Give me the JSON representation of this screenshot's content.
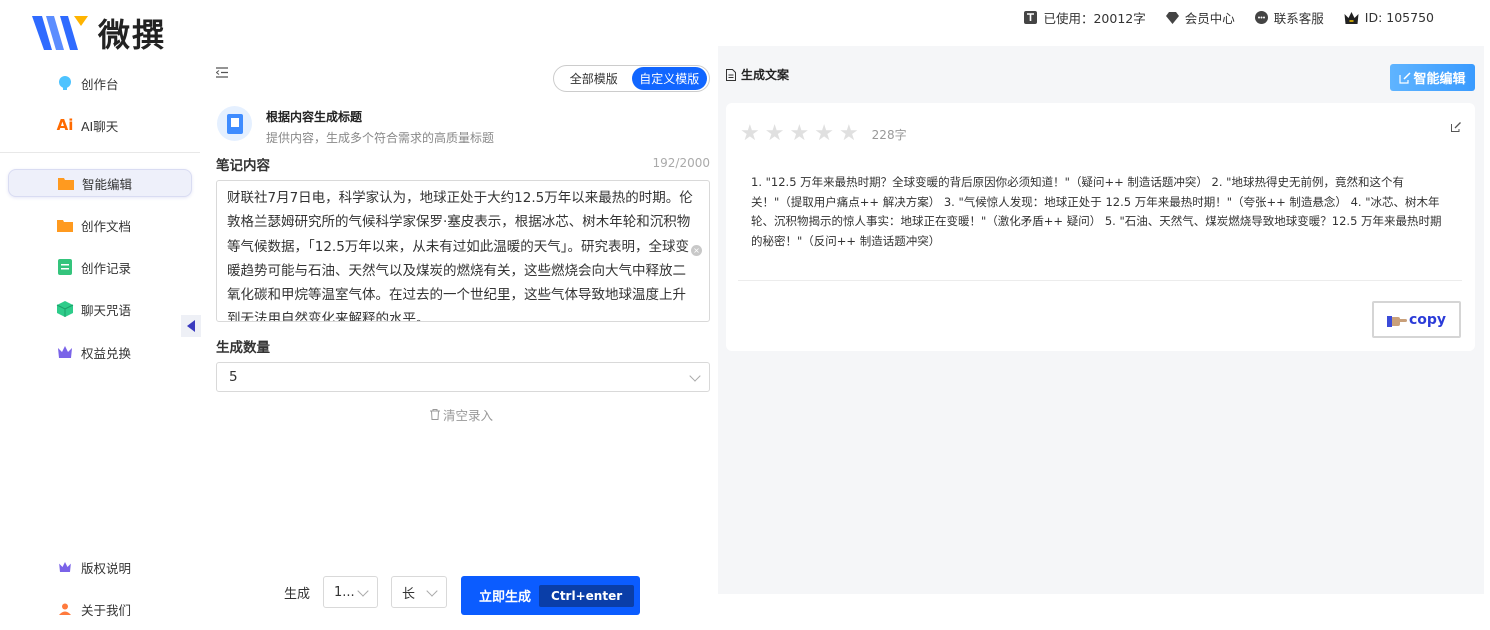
{
  "brand": {
    "name": "微撰"
  },
  "topbar": {
    "usage": "已使用：20012字",
    "member": "会员中心",
    "support": "联系客服",
    "user_id": "ID: 105750"
  },
  "sidebar": {
    "top_items": [
      {
        "label": "创作台",
        "icon": "bulb-icon"
      },
      {
        "label": "AI聊天",
        "icon": "ai-icon"
      }
    ],
    "items": [
      {
        "label": "智能编辑",
        "icon": "folder-icon",
        "active": true
      },
      {
        "label": "创作文档",
        "icon": "folder-icon"
      },
      {
        "label": "创作记录",
        "icon": "document-icon"
      },
      {
        "label": "聊天咒语",
        "icon": "cube-icon"
      },
      {
        "label": "权益兑换",
        "icon": "crown-icon"
      }
    ],
    "bottom_items": [
      {
        "label": "版权说明",
        "icon": "crown-icon"
      },
      {
        "label": "关于我们",
        "icon": "user-icon"
      }
    ],
    "ai_badge": "Ai"
  },
  "template_switch": {
    "all": "全部模版",
    "custom": "自定义模版",
    "selected": "custom"
  },
  "template": {
    "title": "根据内容生成标题",
    "desc": "提供内容，生成多个符合需求的高质量标题"
  },
  "notes": {
    "label": "笔记内容",
    "counter": "192/2000",
    "content": "财联社7月7日电，科学家认为，地球正处于大约12.5万年以来最热的时期。伦敦格兰瑟姆研究所的气候科学家保罗·塞皮表示，根据冰芯、树木年轮和沉积物等气候数据，「12.5万年以来，从未有过如此温暖的天气」。研究表明，全球变暖趋势可能与石油、天然气以及煤炭的燃烧有关，这些燃烧会向大气中释放二氧化碳和甲烷等温室气体。在过去的一个世纪里，这些气体导致地球温度上升到无法用自然变化来解释的水平。"
  },
  "quantity": {
    "label": "生成数量",
    "value": "5"
  },
  "clear_entry": "清空录入",
  "bottom": {
    "gen_label": "生成",
    "select1": "1...",
    "select2": "长",
    "generate_button": "立即生成",
    "shortcut": "Ctrl+enter"
  },
  "output": {
    "header": "生成文案",
    "smart_edit": "智能编辑",
    "rating": 0,
    "word_count": "228字",
    "text": "1. \"12.5 万年来最热时期？全球变暖的背后原因你必须知道！\"（疑问++ 制造话题冲突） 2. \"地球热得史无前例，竟然和这个有关！\"（提取用户痛点++ 解决方案） 3. \"气候惊人发现：地球正处于 12.5 万年来最热时期！\"（夸张++ 制造悬念） 4. \"冰芯、树木年轮、沉积物揭示的惊人事实：地球正在变暖！\"（激化矛盾++ 疑问） 5. \"石油、天然气、煤炭燃烧导致地球变暖？12.5 万年来最热时期的秘密！\"（反问++ 制造话题冲突）",
    "copy_label": "copy"
  },
  "colors": {
    "primary": "#0b5cff",
    "accent": "#3a9bff",
    "copy": "#2b3bd8"
  }
}
